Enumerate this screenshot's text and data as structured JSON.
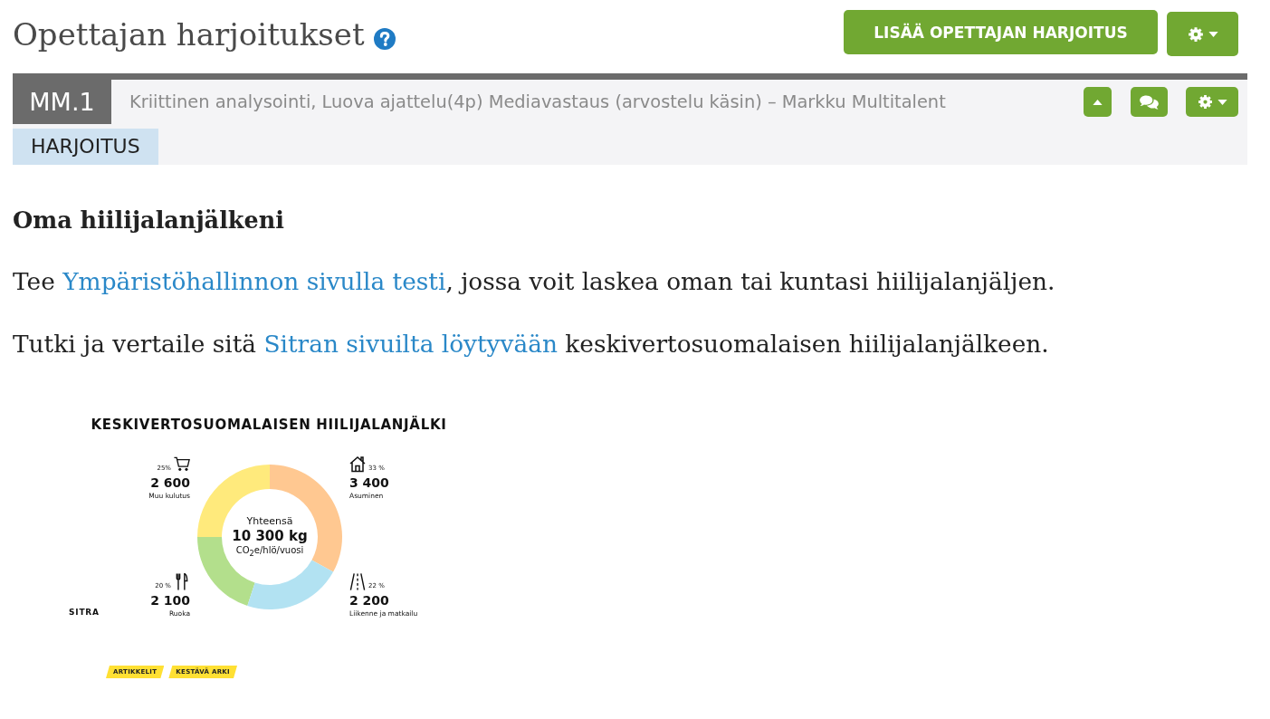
{
  "header": {
    "title": "Opettajan harjoitukset",
    "add_button": "LISÄÄ OPETTAJAN HARJOITUS"
  },
  "exercise": {
    "code": "MM.1",
    "description": "Kriittinen analysointi, Luova ajattelu(4p) Mediavastaus (arvostelu käsin) – Markku Multitalent",
    "type_label": "HARJOITUS"
  },
  "content": {
    "heading": "Oma hiilijalanjälkeni",
    "paragraphs": [
      {
        "parts": [
          {
            "kind": "text",
            "text": "Tee "
          },
          {
            "kind": "link",
            "text": "Ympäristöhallinnon sivulla testi"
          },
          {
            "kind": "text",
            "text": ", jossa voit laskea oman tai kuntasi hiilijalanjäljen."
          }
        ]
      },
      {
        "parts": [
          {
            "kind": "text",
            "text": "Tutki ja vertaile sitä "
          },
          {
            "kind": "link",
            "text": "Sitran sivuilta löytyvään"
          },
          {
            "kind": "text",
            "text": " keskivertosuomalaisen hiilijalanjälkeen."
          }
        ]
      }
    ]
  },
  "infographic": {
    "title": "KESKIVERTOSUOMALAISEN HIILIJALANJÄLKI",
    "chart_data": {
      "type": "donut",
      "categories": [
        "Muu kulutus",
        "Asuminen",
        "Ruoka",
        "Liikenne ja matkailu"
      ],
      "values": [
        25,
        33,
        20,
        22
      ]
    },
    "slices": [
      {
        "percent": "25%",
        "amount": "2 600",
        "color": "#ffea7c"
      },
      {
        "percent": "33 %",
        "amount": "3 400",
        "color": "#ffc891"
      },
      {
        "percent": "20 %",
        "amount": "2 100",
        "color": "#b3df8c"
      },
      {
        "percent": "22 %",
        "amount": "2 200",
        "color": "#b2e2f2"
      }
    ],
    "total_label": "Yhteensä",
    "total": "10 300 kg",
    "unit": "CO$_{2}$e/hlö/vuosi",
    "logo": "SITRA",
    "tags": [
      "ARTIKKELIT",
      "KESTÄVÄ ARKI"
    ]
  }
}
